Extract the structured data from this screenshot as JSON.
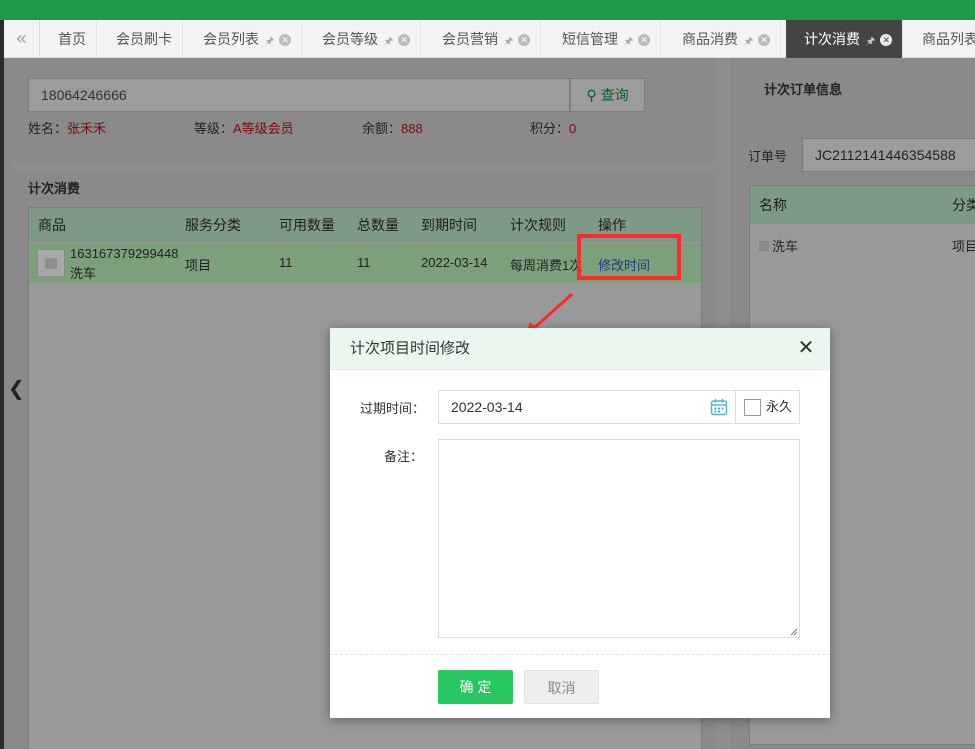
{
  "tabs": {
    "items": [
      {
        "label": "首页"
      },
      {
        "label": "会员刷卡"
      },
      {
        "label": "会员列表"
      },
      {
        "label": "会员等级"
      },
      {
        "label": "会员营销"
      },
      {
        "label": "短信管理"
      },
      {
        "label": "商品消费"
      },
      {
        "label": "计次消费"
      },
      {
        "label": "商品列表"
      }
    ],
    "active": "计次消费"
  },
  "search": {
    "value": "18064246666",
    "button_label": "查询"
  },
  "member": {
    "name_label": "姓名：",
    "name": "张禾禾",
    "level_label": "等级：",
    "level": "A等级会员",
    "balance_label": "余额：",
    "balance": "888",
    "points_label": "积分：",
    "points": "0"
  },
  "section": {
    "title": "计次消费"
  },
  "table": {
    "headers": [
      "商品",
      "服务分类",
      "可用数量",
      "总数量",
      "到期时间",
      "计次规则",
      "操作"
    ],
    "rows": [
      {
        "code": "163167379299448",
        "name": "洗车",
        "category": "项目",
        "available": "11",
        "total": "11",
        "expire": "2022-03-14",
        "rule": "每周消费1次",
        "action": "修改时间"
      }
    ]
  },
  "right": {
    "title": "计次订单信息",
    "order_label": "订单号",
    "order_no": "JC2112141446354588",
    "headers": [
      "名称",
      "分类"
    ],
    "row": {
      "name": "洗车",
      "category": "项目"
    }
  },
  "modal": {
    "title": "计次项目时间修改",
    "expire_label": "过期时间：",
    "expire_value": "2022-03-14",
    "permanent_label": "永久",
    "remark_label": "备注：",
    "ok_label": "确 定",
    "cancel_label": "取消"
  },
  "colors": {
    "accent_green": "#26c85f",
    "topbar_green": "#1f9a4b",
    "highlight_red": "#ff2a2a"
  }
}
